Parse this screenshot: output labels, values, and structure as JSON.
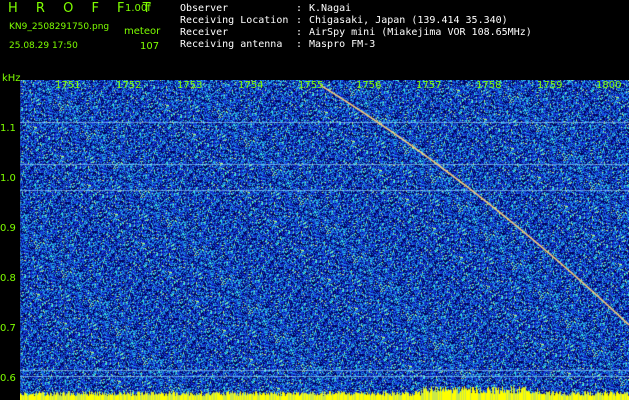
{
  "header": {
    "brand": "H R O F F T",
    "version": "1.00f",
    "filename": "KN9_2508291750.png",
    "mode_label": "meteor",
    "datetime": "25.08.29 17:50",
    "count": "107"
  },
  "info": [
    {
      "key": "Observer",
      "value": "K.Nagai"
    },
    {
      "key": "Receiving Location",
      "value": "Chigasaki, Japan (139.414 35.340)"
    },
    {
      "key": "Receiver",
      "value": "AirSpy mini (Miakejima VOR 108.65MHz)"
    },
    {
      "key": "Receiving antenna",
      "value": "Maspro FM-3"
    }
  ],
  "info_separator": ":",
  "axis": {
    "y_unit": "kHz",
    "y_ticks": [
      "1.1",
      "1.0",
      "0.9",
      "0.8",
      "0.7",
      "0.6"
    ],
    "x_ticks": [
      "1751",
      "1752",
      "1753",
      "1754",
      "1755",
      "1756",
      "1757",
      "1758",
      "1759",
      "1800"
    ]
  },
  "colors": {
    "accent": "#7fff00",
    "text": "#ffffff",
    "noise_base": "#1a2fb8",
    "echo": "#ffd27a",
    "gridline": "#9fdfff",
    "bottom_bar": "#ffff00"
  }
}
